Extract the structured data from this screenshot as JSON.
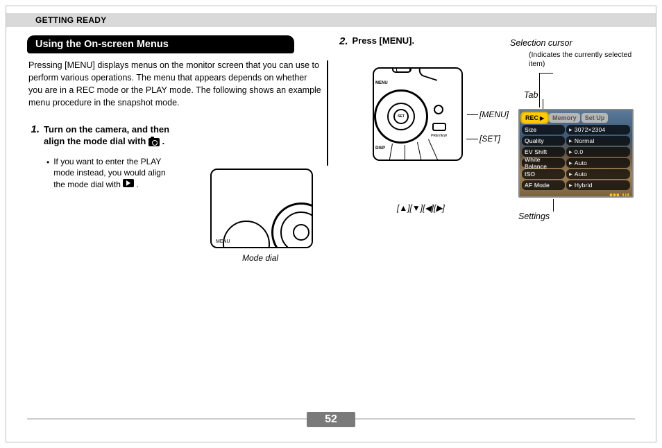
{
  "header": {
    "section": "GETTING READY"
  },
  "section_title": "Using the On-screen Menus",
  "intro": "Pressing [MENU] displays menus on the monitor screen that you can use to perform various operations. The menu that appears depends on whether you are in a REC mode or the PLAY mode. The following shows an example menu procedure in the snapshot mode.",
  "step1": {
    "num": "1.",
    "text_a": "Turn on the camera, and then align the mode dial with ",
    "text_b": ".",
    "bullet": "If you want to enter the PLAY mode instead, you would align the mode dial with ",
    "bullet_b": ".",
    "caption": "Mode dial"
  },
  "step2": {
    "num": "2.",
    "text": "Press [MENU]."
  },
  "labels": {
    "menu": "[MENU]",
    "set": "[SET]",
    "arrows": "[▲][▼][◀][▶]",
    "selection_cursor": "Selection cursor",
    "selection_sub": "(Indicates the currently selected item)",
    "tab": "Tab",
    "settings": "Settings"
  },
  "screen": {
    "tabs": [
      "REC",
      "Memory",
      "Set Up"
    ],
    "rows": [
      {
        "k": "Size",
        "v": "3072×2304"
      },
      {
        "k": "Quality",
        "v": "Normal"
      },
      {
        "k": "EV Shift",
        "v": "0.0"
      },
      {
        "k": "White Balance",
        "v": "Auto"
      },
      {
        "k": "ISO",
        "v": "Auto"
      },
      {
        "k": "AF Mode",
        "v": "Hybrid"
      }
    ],
    "page": "1/4"
  },
  "page_number": "52"
}
